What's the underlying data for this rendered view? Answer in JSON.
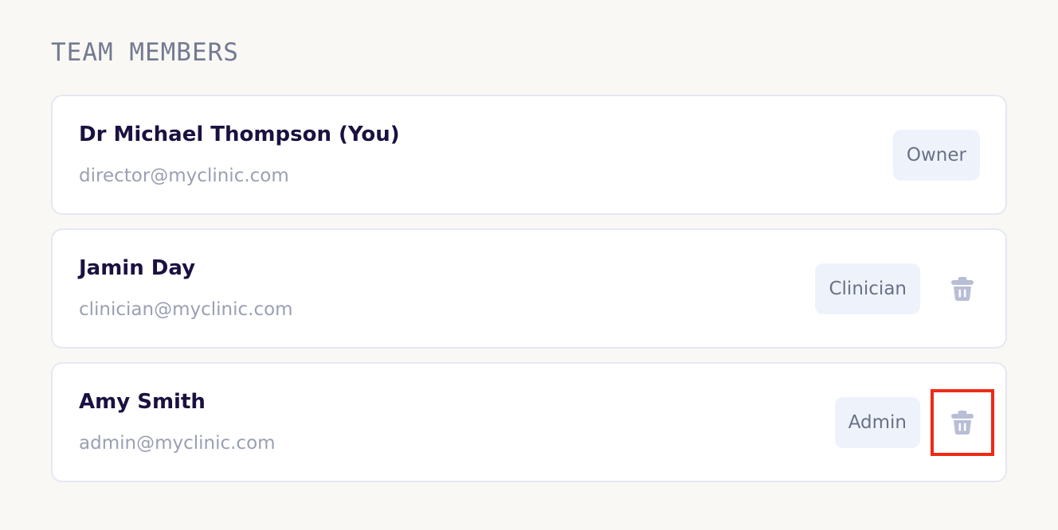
{
  "section": {
    "title": "TEAM MEMBERS"
  },
  "members": [
    {
      "name": "Dr Michael Thompson (You)",
      "email": "director@myclinic.com",
      "role": "Owner",
      "can_delete": false
    },
    {
      "name": "Jamin Day",
      "email": "clinician@myclinic.com",
      "role": "Clinician",
      "can_delete": true,
      "delete_icon": "trash-icon"
    },
    {
      "name": "Amy Smith",
      "email": "admin@myclinic.com",
      "role": "Admin",
      "can_delete": true,
      "delete_icon": "trash-icon",
      "delete_highlighted": true
    }
  ],
  "colors": {
    "background": "#f9f8f5",
    "name_text": "#1b1140",
    "email_text": "#9aa0b3",
    "badge_background": "#eef3fb",
    "icon": "#b9bed6",
    "highlight": "#ee2a16"
  }
}
